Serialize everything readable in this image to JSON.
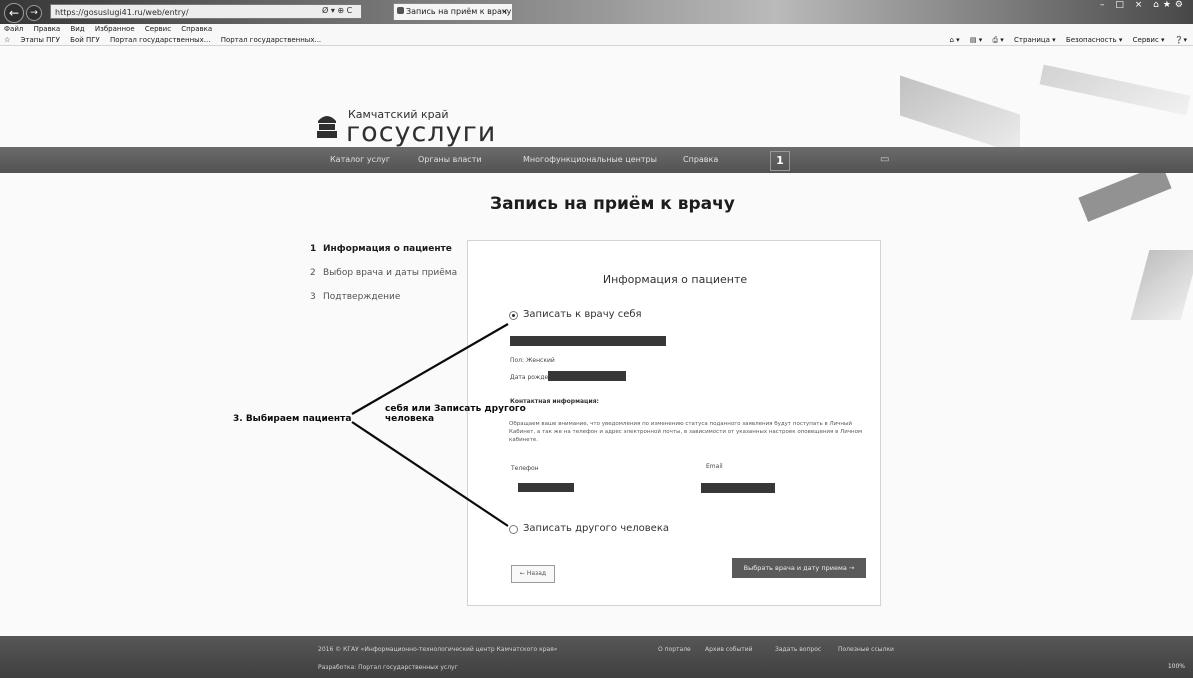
{
  "browser": {
    "address": "https://gosuslugi41.ru/web/entry/",
    "address_tools": "Ø ▾ ⊕ C",
    "tab_title": "Запись на приём к врачу",
    "menu": [
      "Файл",
      "Правка",
      "Вид",
      "Избранное",
      "Сервис",
      "Справка"
    ],
    "favorites": [
      "Этапы ПГУ",
      "Бой ПГУ",
      "Портал государственных...",
      "Портал государственных..."
    ],
    "commands": [
      "Страница ▾",
      "Безопасность ▾",
      "Сервис ▾"
    ],
    "zoom": "100%"
  },
  "header": {
    "region": "Камчатский край",
    "brand": "госуслуги"
  },
  "site_nav": {
    "items": [
      "Каталог услуг",
      "Органы власти",
      "Многофункциональные центры",
      "Справка"
    ],
    "user": "1"
  },
  "page": {
    "title": "Запись на приём к врачу",
    "steps": [
      {
        "num": "1",
        "label": "Информация о пациенте"
      },
      {
        "num": "2",
        "label": "Выбор врача и даты приёма"
      },
      {
        "num": "3",
        "label": "Подтверждение"
      }
    ]
  },
  "form": {
    "title": "Информация о пациенте",
    "option_self": "Записать к врачу себя",
    "gender": "Пол: Женский",
    "dob_label": "Дата рождения",
    "contact_heading": "Контактная информация:",
    "notice": "Обращаем ваше внимание, что уведомления по изменению статуса поданного заявления будут поступать в Личный Кабинет, а так же на телефон и адрес электронной почты, в зависимости от указанных настроек оповещения в Личном кабинете.",
    "phone_label": "Телефон",
    "email_label": "Email",
    "option_other": "Записать другого человека",
    "back_button": "← Назад",
    "next_button": "Выбрать врача и дату приема →"
  },
  "annotation": {
    "step_label": "3. Выбираем пациента",
    "hint": "себя или Записать другого человека"
  },
  "footer": {
    "copyright": "2016 © КГАУ «Информационно-технологический центр Камчатского края»",
    "links": [
      "О портале",
      "Архив событий",
      "Задать вопрос",
      "Полезные ссылки"
    ],
    "bottom_line": "Разработка: Портал государственных услуг"
  }
}
